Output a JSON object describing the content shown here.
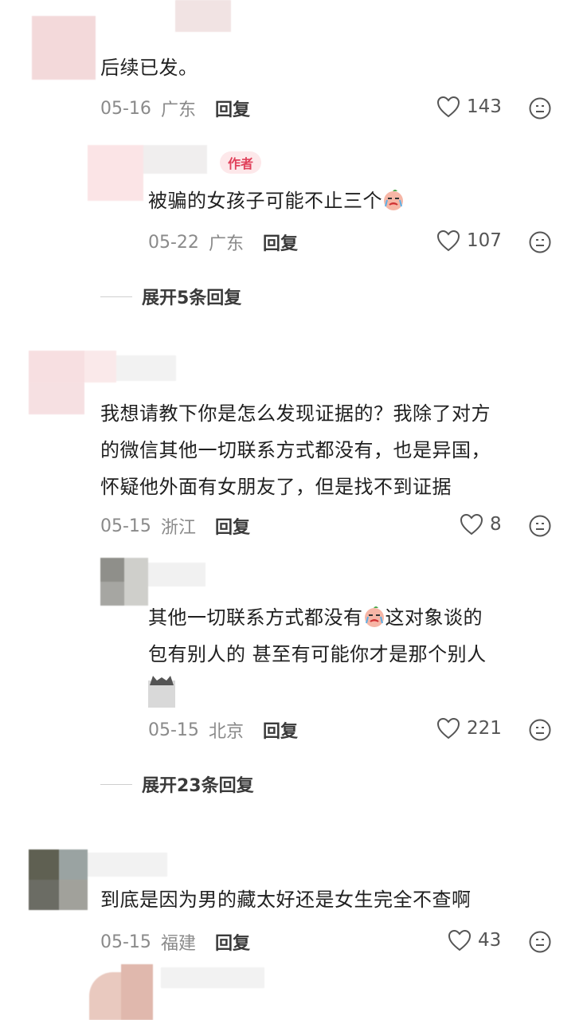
{
  "c1": {
    "text": "后续已发。",
    "date": "05-16",
    "location": "广东",
    "reply_label": "回复",
    "likes": "143"
  },
  "c1_reply": {
    "author_badge": "作者",
    "text": "被骗的女孩子可能不止三个",
    "date": "05-22",
    "location": "广东",
    "reply_label": "回复",
    "likes": "107"
  },
  "expand1": "展开5条回复",
  "c2": {
    "lines": [
      "我想请教下你是怎么发现证据的？我除了对方",
      "的微信其他一切联系方式都没有，也是异国，",
      "怀疑他外面有女朋友了，但是找不到证据"
    ],
    "date": "05-15",
    "location": "浙江",
    "reply_label": "回复",
    "likes": "8"
  },
  "c2_reply": {
    "line1a": "其他一切联系方式都没有",
    "line1b": "这对象谈的",
    "line2": "包有别人的 甚至有可能你才是那个别人",
    "date": "05-15",
    "location": "北京",
    "reply_label": "回复",
    "likes": "221"
  },
  "expand2": "展开23条回复",
  "c3": {
    "text": "到底是因为男的藏太好还是女生完全不查啊",
    "date": "05-15",
    "location": "福建",
    "reply_label": "回复",
    "likes": "43"
  },
  "icons": {
    "like": "heart-outline-icon",
    "dislike": "neutral-face-icon",
    "emoji": "crying-face-emoji"
  },
  "colors": {
    "badge_bg": "#fde8ea",
    "badge_text": "#e0405a"
  }
}
